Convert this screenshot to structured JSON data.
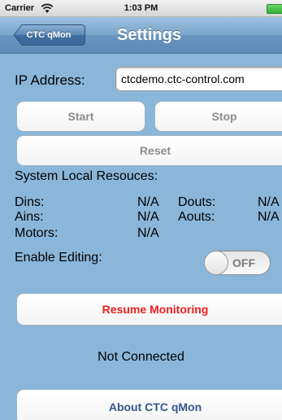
{
  "status_bar": {
    "carrier": "Carrier",
    "time": "1:03 PM"
  },
  "nav": {
    "back_label": "CTC qMon",
    "title": "Settings"
  },
  "ip": {
    "label": "IP Address:",
    "value": "ctcdemo.ctc-control.com"
  },
  "buttons": {
    "start": "Start",
    "stop": "Stop",
    "reset": "Reset",
    "resume": "Resume Monitoring",
    "about": "About CTC qMon"
  },
  "resources": {
    "heading": "System Local Resouces:",
    "dins_label": "Dins:",
    "dins_value": "N/A",
    "douts_label": "Douts:",
    "douts_value": "N/A",
    "ains_label": "Ains:",
    "ains_value": "N/A",
    "aouts_label": "Aouts:",
    "aouts_value": "N/A",
    "motors_label": "Motors:",
    "motors_value": "N/A"
  },
  "editing": {
    "label": "Enable Editing:",
    "toggle_label": "OFF"
  },
  "connection_status": "Not Connected",
  "colors": {
    "background": "#8ab6d9",
    "resume_text": "#ee1c1c",
    "about_text": "#34568b"
  }
}
